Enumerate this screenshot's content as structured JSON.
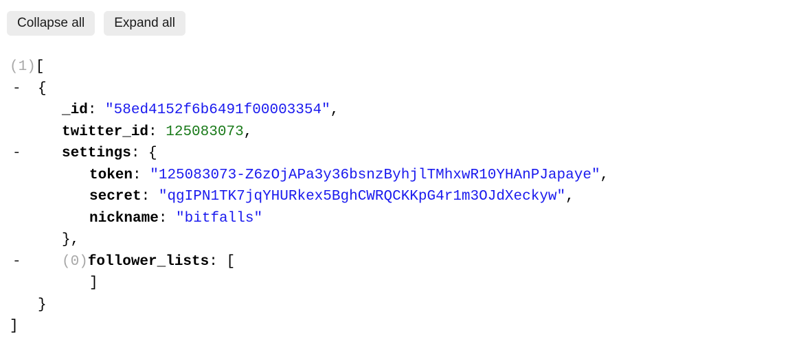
{
  "toolbar": {
    "collapse_all_label": "Collapse all",
    "expand_all_label": "Expand all"
  },
  "colors": {
    "string": "#1a1aee",
    "number": "#1a7a1a",
    "count": "#a8a8a8",
    "key": "#000000",
    "button_bg": "#ececec",
    "background": "#ffffff"
  },
  "viewer": {
    "root_count": "(1)",
    "root_open": "[",
    "root_close": "]",
    "object_toggle": "-",
    "object_open": "{",
    "object_close": "}",
    "lines": [
      {
        "toggle": "",
        "indent": "ind0",
        "key": "",
        "count": "(1)",
        "value": "",
        "open": "[",
        "trail": ""
      },
      {
        "toggle": "-",
        "indent": "ind1",
        "key": "",
        "count": "",
        "value": "",
        "open": "{",
        "trail": ""
      },
      {
        "toggle": "",
        "indent": "ind2",
        "key": "_id",
        "count": "",
        "value": "\"58ed4152f6b6491f00003354\"",
        "value_type": "string",
        "open": "",
        "trail": ","
      },
      {
        "toggle": "",
        "indent": "ind2",
        "key": "twitter_id",
        "count": "",
        "value": "125083073",
        "value_type": "number",
        "open": "",
        "trail": ","
      },
      {
        "toggle": "-",
        "indent": "ind2",
        "key": "settings",
        "count": "",
        "value": "",
        "open": "{",
        "trail": ""
      },
      {
        "toggle": "",
        "indent": "ind3",
        "key": "token",
        "count": "",
        "value": "\"125083073-Z6zOjAPa3y36bsnzByhjlTMhxwR10YHAnPJapaye\"",
        "value_type": "string",
        "open": "",
        "trail": ","
      },
      {
        "toggle": "",
        "indent": "ind3",
        "key": "secret",
        "count": "",
        "value": "\"qgIPN1TK7jqYHURkex5BghCWRQCKKpG4r1m3OJdXeckyw\"",
        "value_type": "string",
        "open": "",
        "trail": ","
      },
      {
        "toggle": "",
        "indent": "ind3",
        "key": "nickname",
        "count": "",
        "value": "\"bitfalls\"",
        "value_type": "string",
        "open": "",
        "trail": ""
      },
      {
        "toggle": "",
        "indent": "ind2",
        "key": "",
        "count": "",
        "value": "",
        "open": "},",
        "trail": ""
      },
      {
        "toggle": "-",
        "indent": "ind2",
        "key": "follower_lists",
        "count": "(0)",
        "value": "",
        "open": "[",
        "trail": ""
      },
      {
        "toggle": "",
        "indent": "ind3",
        "key": "",
        "count": "",
        "value": "",
        "open": "]",
        "trail": ""
      },
      {
        "toggle": "",
        "indent": "ind1",
        "key": "",
        "count": "",
        "value": "",
        "open": "}",
        "trail": ""
      },
      {
        "toggle": "",
        "indent": "ind0",
        "key": "",
        "count": "",
        "value": "",
        "open": "]",
        "trail": ""
      }
    ]
  },
  "json_document": {
    "type": "array",
    "length": 1,
    "items": [
      {
        "_id": "58ed4152f6b6491f00003354",
        "twitter_id": 125083073,
        "settings": {
          "token": "125083073-Z6zOjAPa3y36bsnzByhjlTMhxwR10YHAnPJapaye",
          "secret": "qgIPN1TK7jqYHURkex5BghCWRQCKKpG4r1m3OJdXeckyw",
          "nickname": "bitfalls"
        },
        "follower_lists": []
      }
    ]
  }
}
